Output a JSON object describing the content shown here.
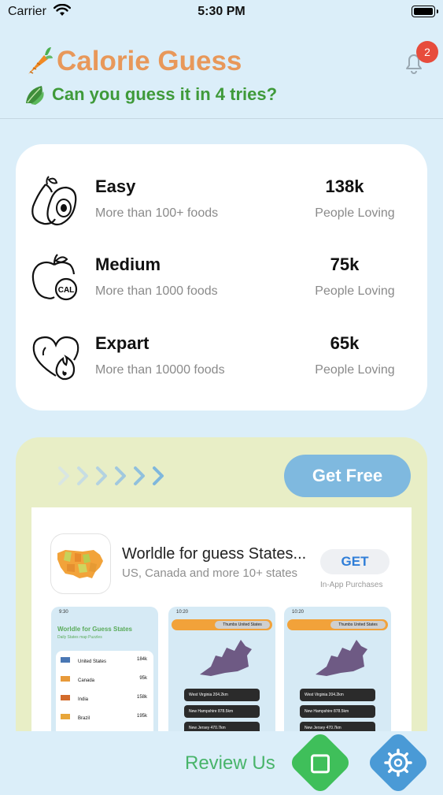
{
  "status_bar": {
    "carrier": "Carrier",
    "time": "5:30 PM"
  },
  "header": {
    "title": "Calorie Guess",
    "subtitle": "Can you guess it in 4 tries?",
    "notification_count": "2"
  },
  "levels": [
    {
      "name": "Easy",
      "description": "More than 100+ foods",
      "count": "138k",
      "count_label": "People Loving",
      "icon": "avocado-pear-icon"
    },
    {
      "name": "Medium",
      "description": "More than 1000 foods",
      "count": "75k",
      "count_label": "People Loving",
      "icon": "apple-calorie-icon"
    },
    {
      "name": "Expart",
      "description": "More than 10000 foods",
      "count": "65k",
      "count_label": "People Loving",
      "icon": "heart-flame-icon"
    }
  ],
  "promo": {
    "button_label": "Get Free",
    "ad": {
      "app_name": "Worldle for guess States...",
      "app_subtitle": "US, Canada and more 10+ states",
      "get_label": "GET",
      "iap_label": "In-App Purchases",
      "screenshots": [
        {
          "time": "9:30",
          "title": "Worldle for Guess States",
          "subtitle": "Daily States map Puzzles",
          "rows": [
            {
              "name": "United States",
              "value": "184k"
            },
            {
              "name": "Canada",
              "value": "95k"
            },
            {
              "name": "India",
              "value": "158k"
            },
            {
              "name": "Brazil",
              "value": "195k"
            }
          ]
        },
        {
          "time": "10:20",
          "chip": "Thumbs United States",
          "answers": [
            "West Virginia 204.2km",
            "New Hampshire 878.5km",
            "New Jersey 470.7km"
          ]
        },
        {
          "time": "10:20",
          "chip": "Thumbs United States",
          "answers": [
            "West Virginia 204.2km",
            "New Hampshire 878.5km",
            "New Jersey 470.7km"
          ]
        }
      ]
    }
  },
  "bottom": {
    "review_label": "Review Us"
  },
  "colors": {
    "title": "#e8985a",
    "subtitle": "#3f9a3a",
    "review": "#48b46a",
    "get_free": "#7fb9df",
    "badge": "#e74c3c"
  }
}
